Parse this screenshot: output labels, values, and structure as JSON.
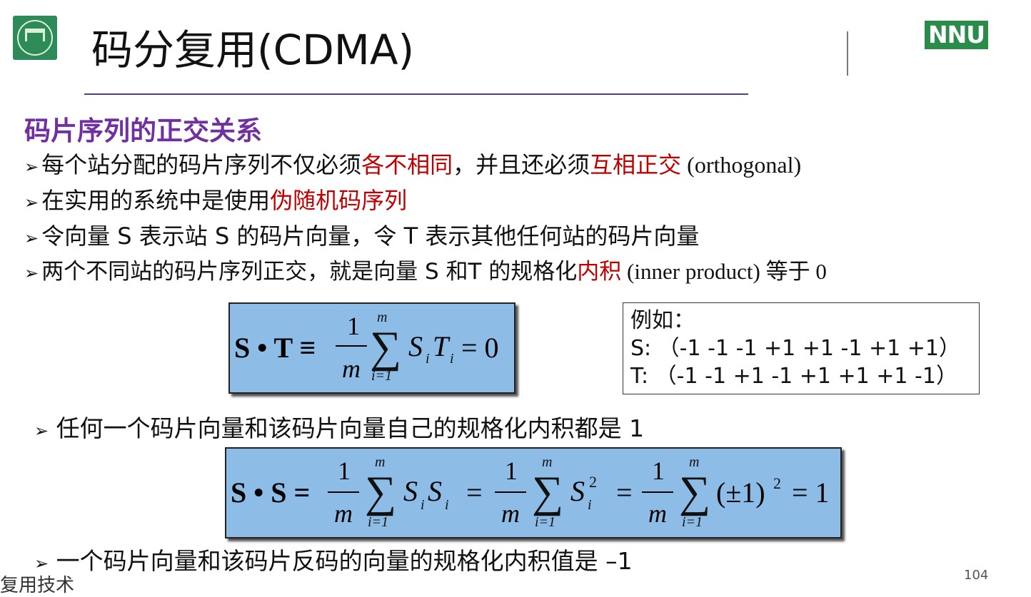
{
  "header": {
    "title": "码分复用(CDMA)",
    "logo_right": "NNU"
  },
  "section": {
    "heading": "码片序列的正交关系"
  },
  "bullets": [
    {
      "parts": [
        "每个站分配的码片序列不仅必须",
        "各不相同",
        "，并且还必须",
        "互相正交",
        " (orthogonal)"
      ]
    },
    {
      "parts": [
        "在实用的系统中是使用",
        "伪随机码序列"
      ]
    },
    {
      "parts": [
        "令向量 S 表示站 S 的码片向量，令 T 表示其他任何站的码片向量"
      ]
    },
    {
      "parts": [
        "两个不同站的码片序列正交，就是向量 S 和T 的规格化",
        "内积",
        " (inner product) 等于 0"
      ]
    }
  ],
  "formula1": {
    "lhs": "S • T ≡",
    "num": "1",
    "den": "m",
    "upper": "m",
    "lower": "i=1",
    "term": "S",
    "term_sub": "i",
    "term2": "T",
    "term2_sub": "i",
    "rhs": "= 0"
  },
  "example": {
    "label": "例如：",
    "s_line": "S: （-1 -1 -1 +1 +1 -1 +1 +1）",
    "t_line": "T: （-1 -1 +1 -1 +1 +1 +1 -1）"
  },
  "bullet5": "任何一个码片向量和该码片向量自己的规格化内积都是 1",
  "formula2": {
    "lhs": "S • S =",
    "num": "1",
    "den": "m",
    "upper": "m",
    "lower": "i=1",
    "t1": "S",
    "t1_sub": "i",
    "t2": "S",
    "t2_sub": "i",
    "eq2": "=",
    "t3": "S",
    "t3_sup": "2",
    "t3_sub": "i",
    "eq3": "=",
    "t4": "(±1)",
    "t4_sup": "2",
    "rhs": "= 1"
  },
  "bullet6": "一个码片向量和该码片反码的向量的规格化内积值是 –1",
  "footer": {
    "left": "复用技术",
    "page": "104"
  }
}
